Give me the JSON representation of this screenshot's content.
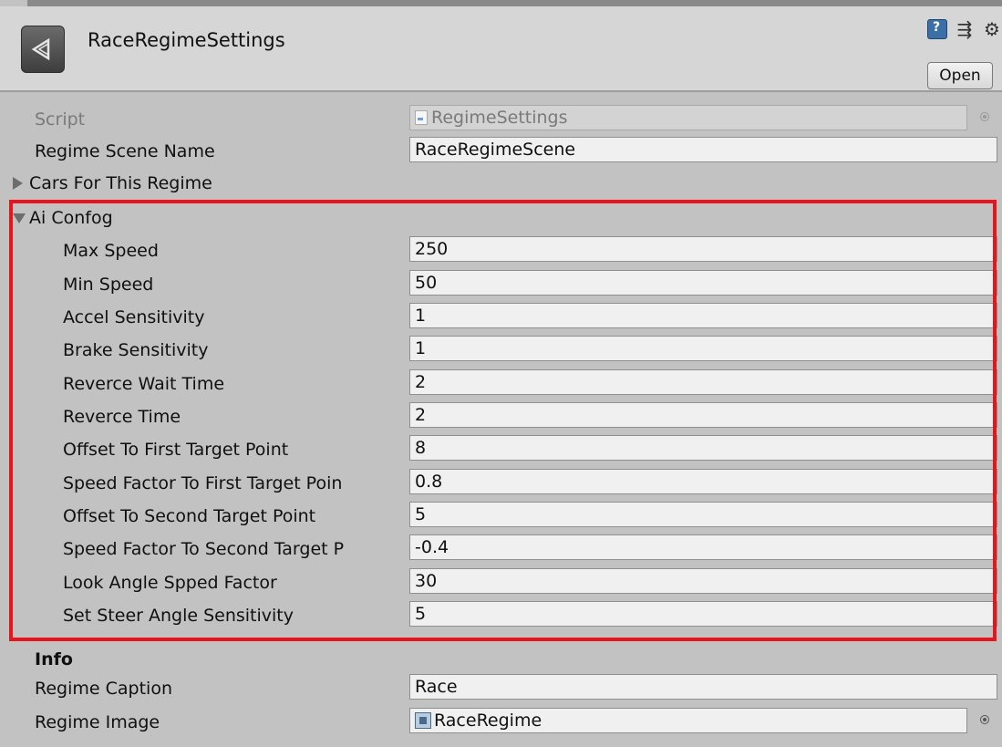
{
  "header": {
    "title": "RaceRegimeSettings",
    "open_label": "Open"
  },
  "script_row": {
    "label": "Script",
    "value": "RegimeSettings"
  },
  "scene_row": {
    "label": "Regime Scene Name",
    "value": "RaceRegimeScene"
  },
  "cars_foldout": {
    "label": "Cars For This Regime"
  },
  "ai_config": {
    "label": "Ai Confog",
    "fields": [
      {
        "label": "Max Speed",
        "value": "250"
      },
      {
        "label": "Min Speed",
        "value": "50"
      },
      {
        "label": "Accel Sensitivity",
        "value": "1"
      },
      {
        "label": "Brake Sensitivity",
        "value": "1"
      },
      {
        "label": "Reverce Wait Time",
        "value": "2"
      },
      {
        "label": "Reverce Time",
        "value": "2"
      },
      {
        "label": "Offset To First Target Point",
        "value": "8"
      },
      {
        "label": "Speed Factor To First Target Poin",
        "value": "0.8"
      },
      {
        "label": "Offset To Second Target Point",
        "value": "5"
      },
      {
        "label": "Speed Factor To Second Target P",
        "value": "-0.4"
      },
      {
        "label": "Look Angle Spped Factor",
        "value": "30"
      },
      {
        "label": "Set Steer Angle Sensitivity",
        "value": "5"
      }
    ]
  },
  "info": {
    "header": "Info",
    "caption_label": "Regime Caption",
    "caption_value": "Race",
    "image_label": "Regime Image",
    "image_value": "RaceRegime"
  },
  "colors": {
    "highlight_border": "#e8131b",
    "panel_bg": "#c2c2c2",
    "header_bg": "#d6d6d6"
  },
  "icons": {
    "asset": "unity-logo-icon",
    "help": "help-book-icon",
    "preset": "preset-settings-icon",
    "gear": "gear-icon",
    "script": "script-file-icon",
    "sprite": "sprite-icon",
    "object_picker": "object-picker-icon"
  }
}
